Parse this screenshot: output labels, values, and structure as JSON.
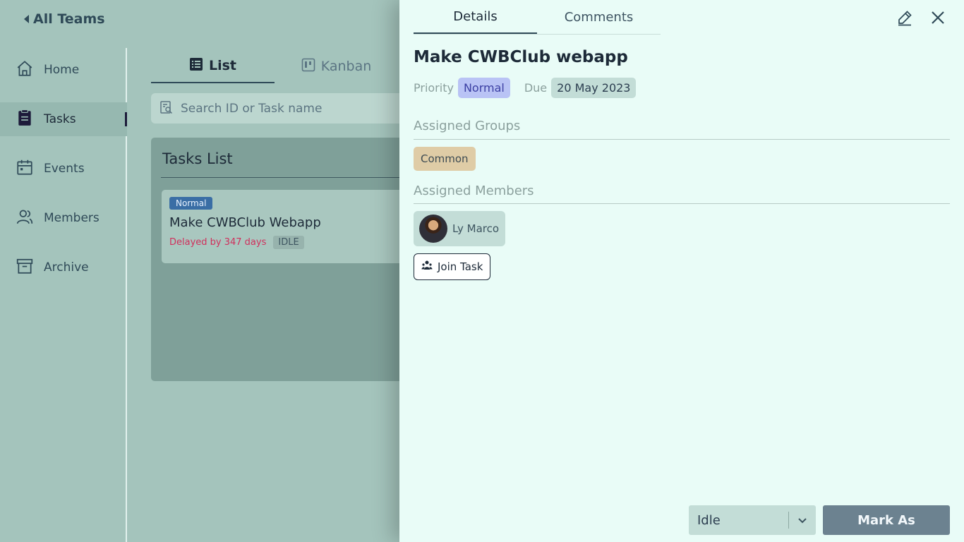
{
  "header": {
    "back_label": "All Teams"
  },
  "sidebar": {
    "items": [
      {
        "label": "Home",
        "icon": "home-icon"
      },
      {
        "label": "Tasks",
        "icon": "tasks-icon",
        "active": true
      },
      {
        "label": "Events",
        "icon": "calendar-icon"
      },
      {
        "label": "Members",
        "icon": "members-icon"
      },
      {
        "label": "Archive",
        "icon": "archive-icon"
      }
    ]
  },
  "views": {
    "tabs": [
      {
        "label": "List",
        "icon": "list-icon",
        "active": true
      },
      {
        "label": "Kanban",
        "icon": "kanban-icon"
      }
    ]
  },
  "search": {
    "placeholder": "Search ID or Task name"
  },
  "tasks_list": {
    "title": "Tasks List",
    "card": {
      "priority": "Normal",
      "title": "Make CWBClub Webapp",
      "delay": "Delayed by 347 days",
      "status": "IDLE"
    }
  },
  "drawer": {
    "tabs": [
      {
        "label": "Details",
        "active": true
      },
      {
        "label": "Comments"
      }
    ],
    "task_title": "Make CWBClub webapp",
    "priority_label": "Priority",
    "priority_value": "Normal",
    "due_label": "Due",
    "due_value": "20 May 2023",
    "groups_label": "Assigned Groups",
    "groups": [
      "Common"
    ],
    "members_label": "Assigned Members",
    "members": [
      {
        "name": "Ly Marco"
      }
    ],
    "join_label": "Join Task",
    "status_value": "Idle",
    "mark_label": "Mark As"
  },
  "colors": {
    "background": "#a4c4bc",
    "drawer": "#e9fcf7",
    "priority_pill": "#b9c3f5",
    "group_chip": "#dfcca6",
    "mark_button": "#6c8290",
    "delay_text": "#d0305c"
  }
}
